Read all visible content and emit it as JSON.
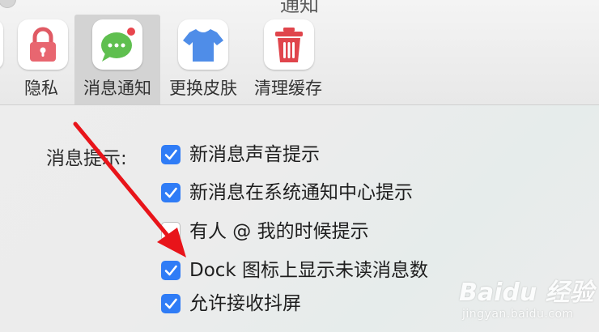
{
  "window": {
    "title": "通知"
  },
  "toolbar": {
    "tabs": [
      {
        "label": "隐私",
        "icon": "lock-icon",
        "selected": false
      },
      {
        "label": "消息通知",
        "icon": "chat-bubble-icon",
        "selected": true
      },
      {
        "label": "更换皮肤",
        "icon": "tshirt-icon",
        "selected": false
      },
      {
        "label": "清理缓存",
        "icon": "trash-icon",
        "selected": false
      }
    ]
  },
  "notifications": {
    "section_label": "消息提示:",
    "options": [
      {
        "label": "新消息声音提示",
        "checked": true
      },
      {
        "label": "新消息在系统通知中心提示",
        "checked": true
      },
      {
        "label": "有人 @ 我的时候提示",
        "checked": false
      },
      {
        "label": "Dock 图标上显示未读消息数",
        "checked": true
      },
      {
        "label": "允许接收抖屏",
        "checked": true
      }
    ]
  },
  "watermark": {
    "text": "Baidu 经验",
    "url_text": "jingyan.baidu.com"
  },
  "colors": {
    "accent": "#2f7cf6",
    "arrow": "#e8141a",
    "selected_tab_bg": "#d3d3d3"
  }
}
